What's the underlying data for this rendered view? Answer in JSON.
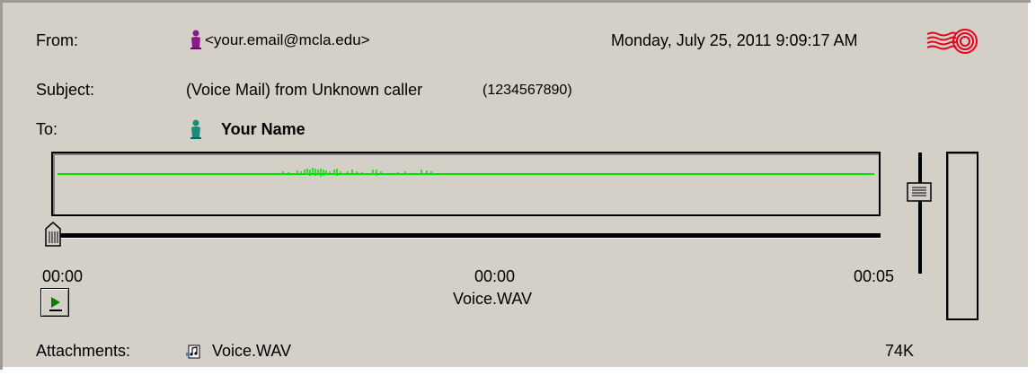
{
  "header": {
    "from_label": "From:",
    "from_value": "<your.email@mcla.edu>",
    "date_value": "Monday, July 25, 2011 9:09:17 AM",
    "subject_label": "Subject:",
    "subject_value": "(Voice Mail) from Unknown caller",
    "subject_number": "(1234567890)",
    "to_label": "To:",
    "to_value": "Your Name"
  },
  "player": {
    "time_start": "00:00",
    "time_current": "00:00",
    "time_end": "00:05",
    "file_name": "Voice.WAV",
    "position_fraction": 0,
    "volume_fraction": 0.75
  },
  "attachments": {
    "label": "Attachments:",
    "file_name": "Voice.WAV",
    "size": "74K"
  },
  "icons": {
    "from": "person-icon",
    "to": "person-icon",
    "priority": "postmark-stamp-icon",
    "play": "play-icon",
    "attachment": "audio-file-icon"
  },
  "colors": {
    "panel_bg": "#d4d0c8",
    "waveform": "#00e000",
    "stamp": "#e8001c",
    "play_arrow": "#008000",
    "from_person": "#8a1a8a",
    "to_person": "#1a8a7a"
  }
}
